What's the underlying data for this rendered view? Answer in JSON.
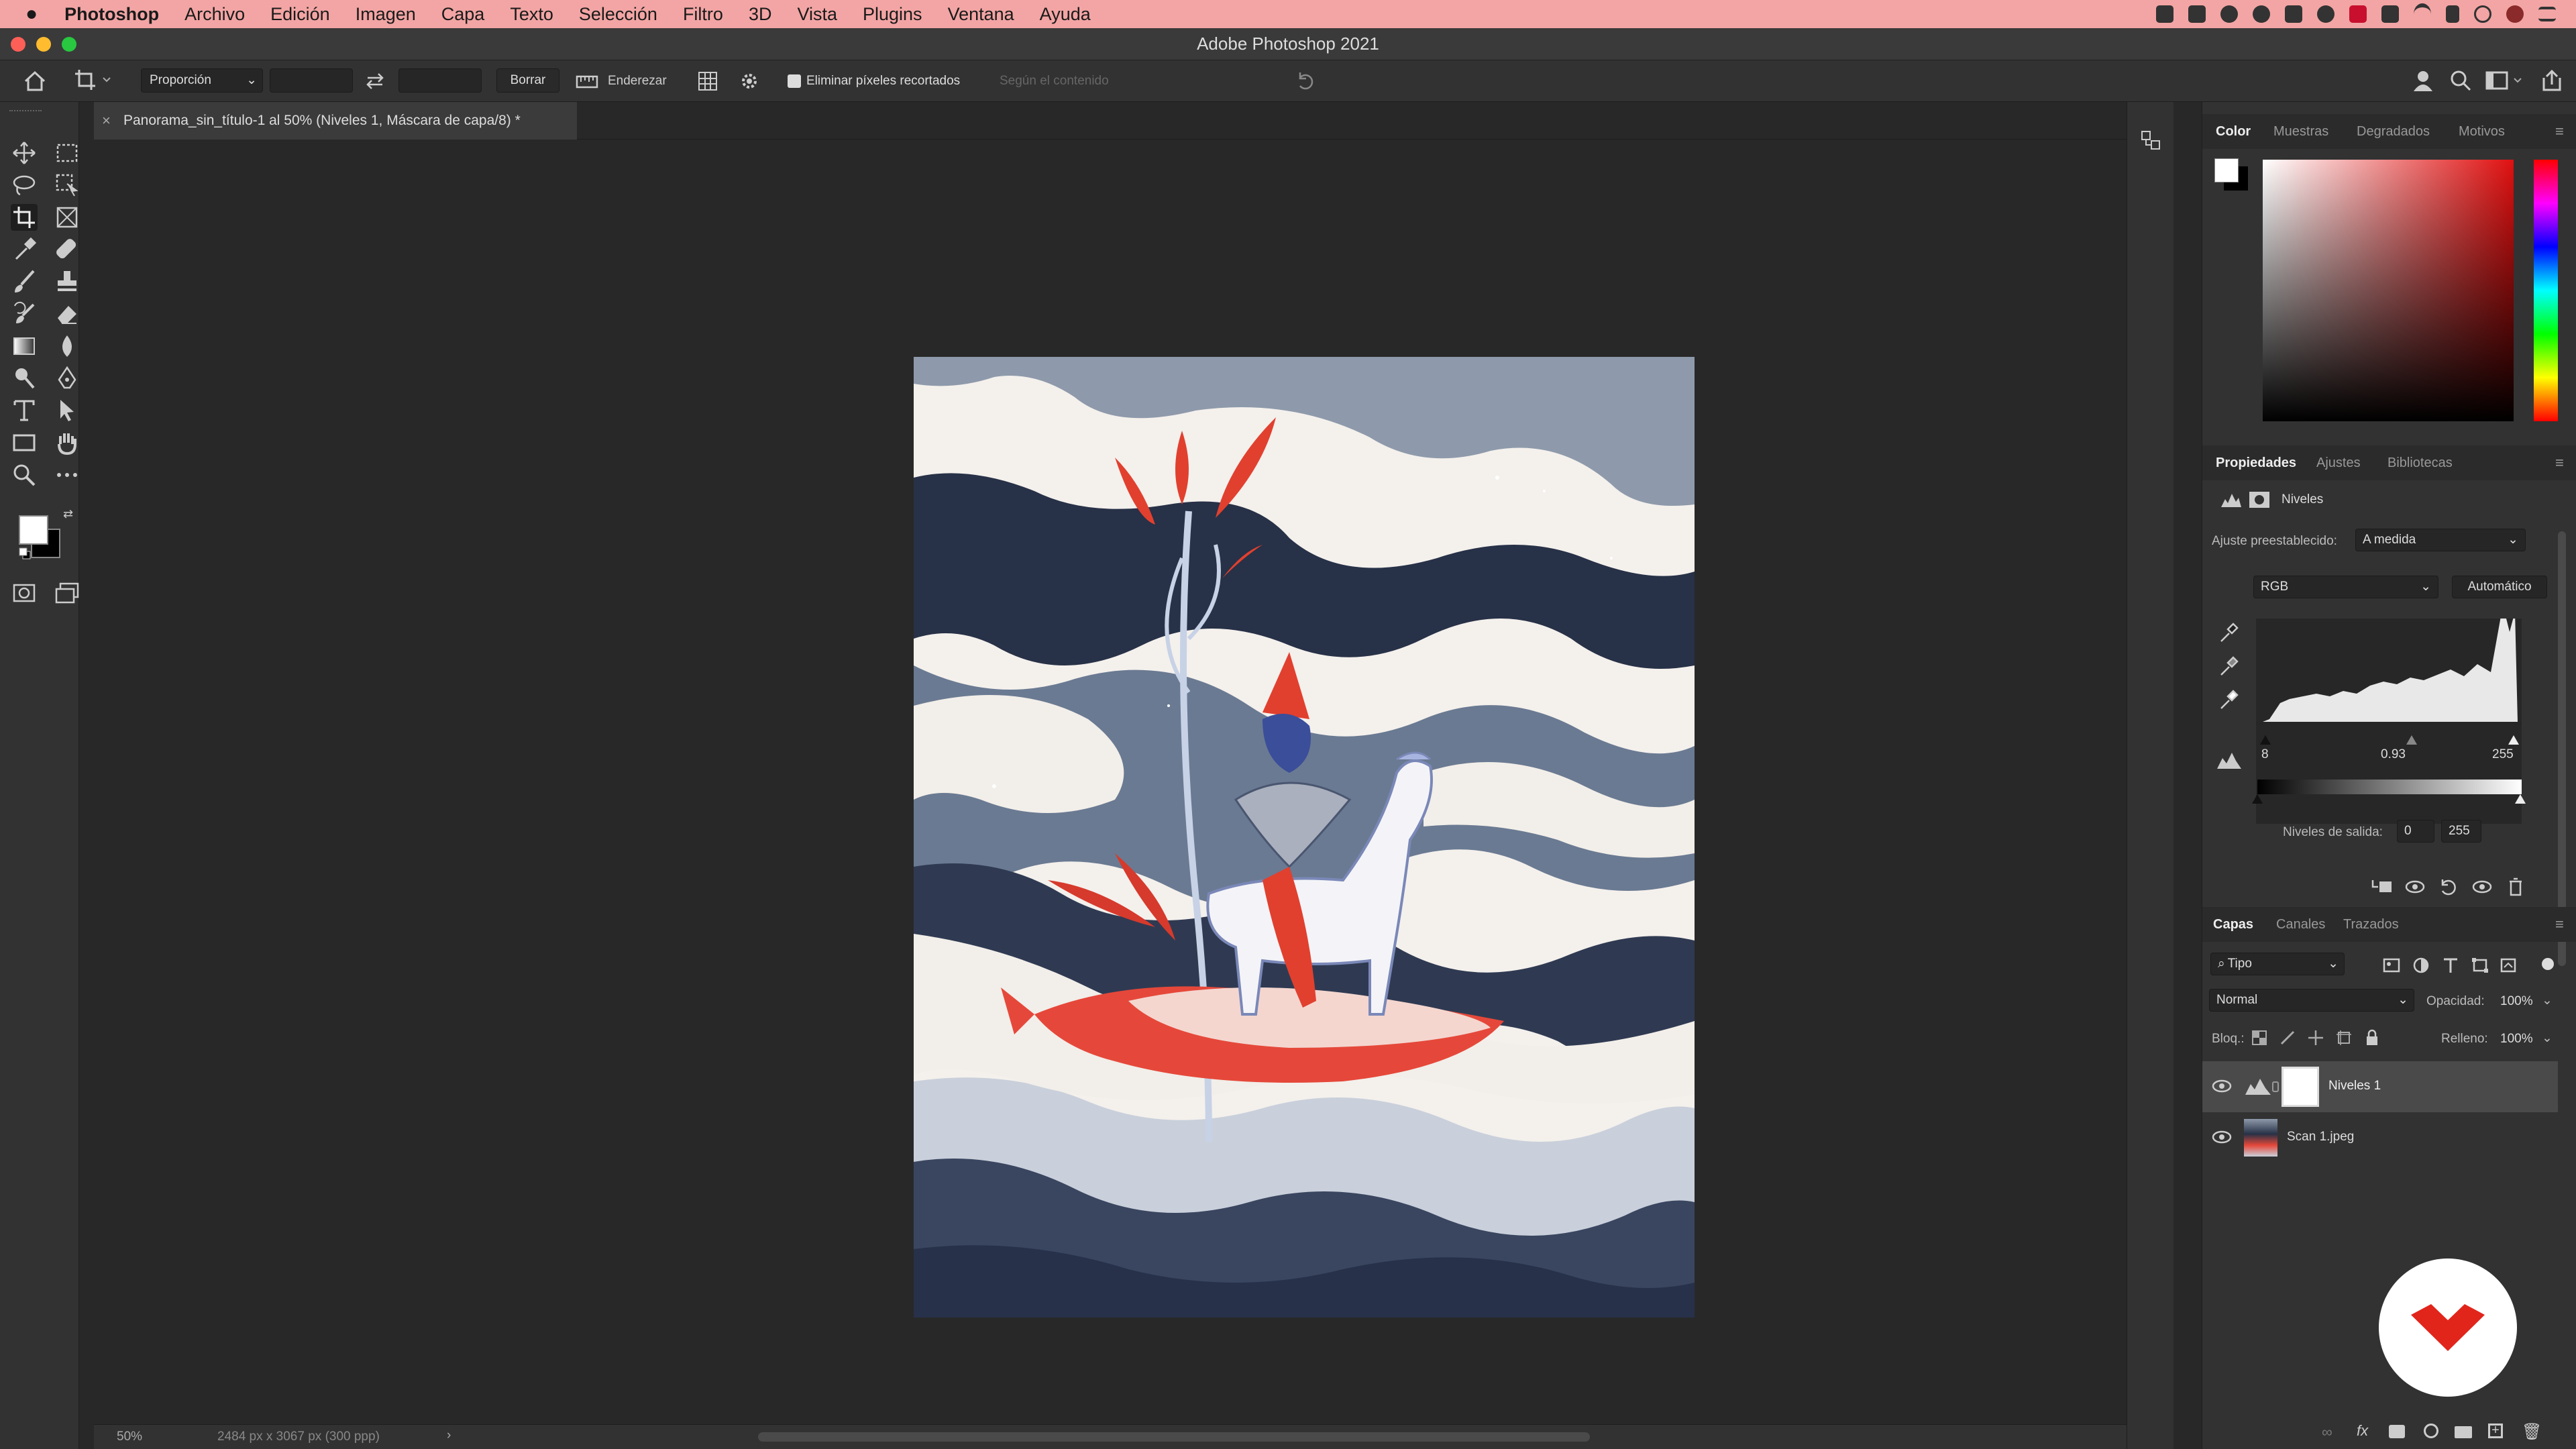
{
  "menubar": {
    "app": "Photoshop",
    "items": [
      "Archivo",
      "Edición",
      "Imagen",
      "Capa",
      "Texto",
      "Selección",
      "Filtro",
      "3D",
      "Vista",
      "Plugins",
      "Ventana",
      "Ayuda"
    ]
  },
  "window": {
    "title": "Adobe Photoshop 2021"
  },
  "options": {
    "ratio": "Proporción",
    "clear": "Borrar",
    "straighten": "Enderezar",
    "delete_cropped": "Eliminar píxeles recortados",
    "content_aware": "Según el contenido"
  },
  "document": {
    "tab_title": "Panorama_sin_título-1 al 50% (Niveles 1, Máscara de capa/8) *",
    "zoom": "50%",
    "dimensions": "2484 px x 3067 px (300 ppp)"
  },
  "color_panel": {
    "tabs": [
      "Color",
      "Muestras",
      "Degradados",
      "Motivos"
    ]
  },
  "properties": {
    "tabs": [
      "Propiedades",
      "Ajustes",
      "Bibliotecas"
    ],
    "adjustment_name": "Niveles",
    "preset_label": "Ajuste preestablecido:",
    "preset_value": "A medida",
    "channel": "RGB",
    "auto": "Automático",
    "input_black": "8",
    "input_gamma": "0.93",
    "input_white": "255",
    "output_label": "Niveles de salida:",
    "output_black": "0",
    "output_white": "255"
  },
  "layers": {
    "tabs": [
      "Capas",
      "Canales",
      "Trazados"
    ],
    "filter": "Tipo",
    "blend_mode": "Normal",
    "opacity_label": "Opacidad:",
    "opacity": "100%",
    "lock_label": "Bloq.:",
    "fill_label": "Relleno:",
    "fill": "100%",
    "items": [
      {
        "name": "Niveles 1"
      },
      {
        "name": "Scan 1.jpeg"
      }
    ]
  },
  "colors": {
    "accent": "#e1251b",
    "menubar": "#f2a5a4"
  }
}
